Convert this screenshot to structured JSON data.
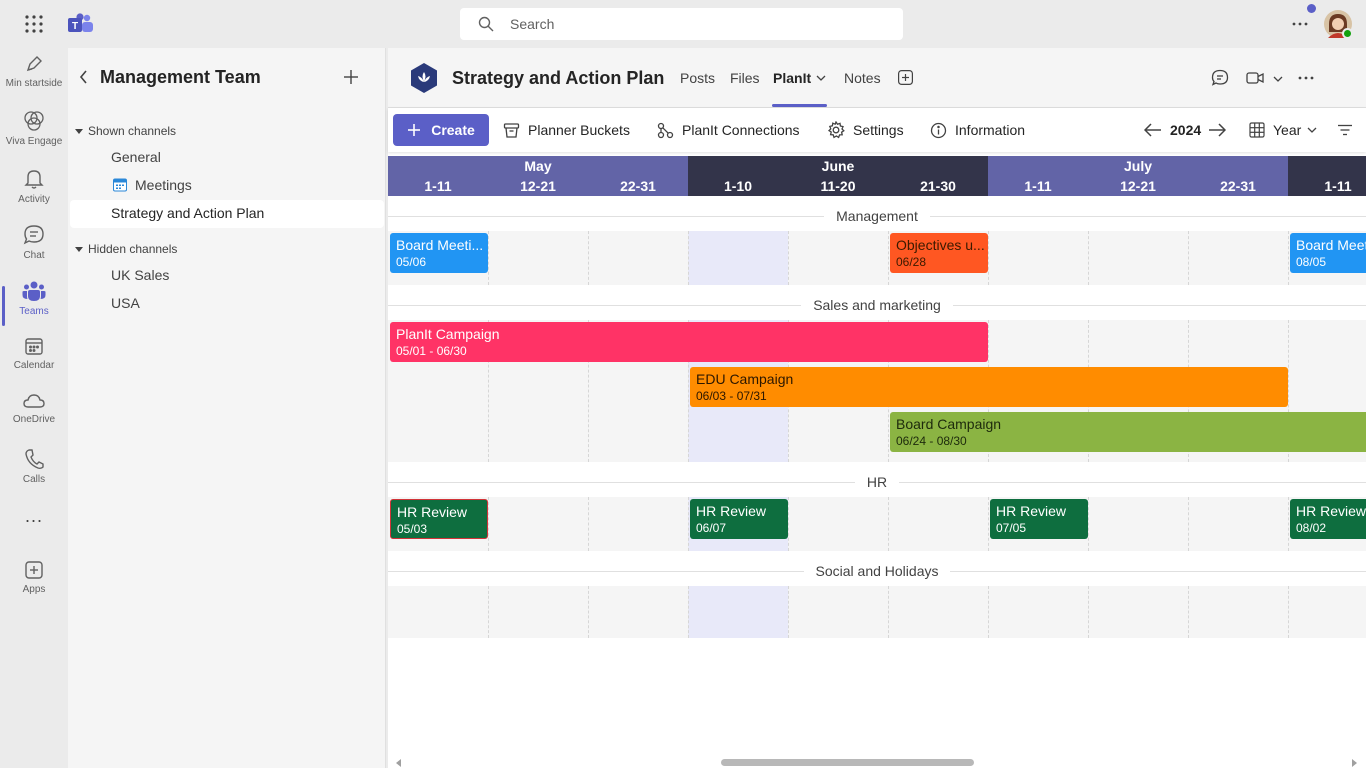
{
  "search": {
    "placeholder": "Search"
  },
  "rail": {
    "items": [
      {
        "label": "Min startside",
        "icon": "pen-icon"
      },
      {
        "label": "Viva Engage",
        "icon": "viva-engage-icon"
      },
      {
        "label": "Activity",
        "icon": "bell-icon"
      },
      {
        "label": "Chat",
        "icon": "chat-icon"
      },
      {
        "label": "Teams",
        "icon": "teams-icon"
      },
      {
        "label": "Calendar",
        "icon": "calendar-icon"
      },
      {
        "label": "OneDrive",
        "icon": "cloud-icon"
      },
      {
        "label": "Calls",
        "icon": "phone-icon"
      },
      {
        "label": "...",
        "icon": "more-icon"
      },
      {
        "label": "Apps",
        "icon": "add-apps-icon"
      }
    ]
  },
  "team": {
    "name": "Management Team",
    "shown_label": "Shown channels",
    "shown": [
      "General",
      "Meetings",
      "Strategy and Action Plan"
    ],
    "hidden_label": "Hidden channels",
    "hidden": [
      "UK Sales",
      "USA"
    ]
  },
  "header": {
    "title": "Strategy and Action Plan",
    "tabs": [
      "Posts",
      "Files",
      "PlanIt",
      "Notes"
    ]
  },
  "toolbar": {
    "create": "Create",
    "buckets": "Planner Buckets",
    "connections": "PlanIt Connections",
    "settings": "Settings",
    "information": "Information",
    "year": "2024",
    "view": "Year"
  },
  "timeline": {
    "months": [
      {
        "name": "May",
        "ranges": [
          "1-11",
          "12-21",
          "22-31"
        ],
        "color": "#6264a7"
      },
      {
        "name": "June",
        "ranges": [
          "1-10",
          "11-20",
          "21-30"
        ],
        "color": "#33344a"
      },
      {
        "name": "July",
        "ranges": [
          "1-11",
          "12-21",
          "22-31"
        ],
        "color": "#6264a7"
      },
      {
        "name": "",
        "ranges": [
          "1-11"
        ],
        "color": "#33344a"
      }
    ],
    "groups": [
      "Management",
      "Sales and marketing",
      "HR",
      "Social and Holidays"
    ],
    "events": {
      "board1": {
        "title": "Board Meeti...",
        "date": "05/06",
        "color": "#2195f3"
      },
      "objectives": {
        "title": "Objectives u...",
        "date": "06/28",
        "color": "#ff5722"
      },
      "board2": {
        "title": "Board Meet",
        "date": "08/05",
        "color": "#2195f3"
      },
      "planit": {
        "title": "PlanIt Campaign",
        "date": "05/01 - 06/30",
        "color": "#ff3366"
      },
      "edu": {
        "title": "EDU Campaign",
        "date": "06/03 - 07/31",
        "color": "#ff8c00"
      },
      "boardc": {
        "title": "Board Campaign",
        "date": "06/24 - 08/30",
        "color": "#8bb443"
      },
      "hr1": {
        "title": "HR Review",
        "date": "05/03",
        "color": "#0e6e3f"
      },
      "hr2": {
        "title": "HR Review",
        "date": "06/07",
        "color": "#0e6e3f"
      },
      "hr3": {
        "title": "HR Review",
        "date": "07/05",
        "color": "#0e6e3f"
      },
      "hr4": {
        "title": "HR Review",
        "date": "08/02",
        "color": "#0e6e3f"
      }
    }
  }
}
